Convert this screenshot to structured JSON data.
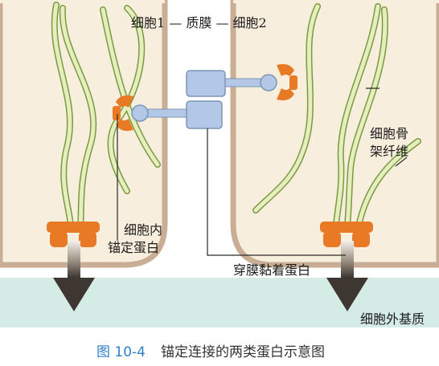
{
  "labels": {
    "membrane": "细胞1 — 质膜 — 细胞2",
    "cytoskeleton_line1": "细胞骨",
    "cytoskeleton_line2": "架纤维",
    "anchor_line1": "细胞内",
    "anchor_line2": "锚定蛋白",
    "transmembrane": "穿膜黏着蛋白",
    "ecm": "细胞外基质"
  },
  "caption": {
    "number": "图 10-4",
    "text": "锚定连接的两类蛋白示意图"
  },
  "colors": {
    "cytoplasm": "#f8eedd",
    "membrane": "#c9ad95",
    "extracellular_matrix": "#d4ebe6",
    "fiber_fill": "#e6eec0",
    "fiber_stroke": "#7a9a40",
    "anchor_protein": "#e97a25",
    "transmembrane_protein": "#b2c8e6",
    "caption_blue": "#2f80c8"
  }
}
